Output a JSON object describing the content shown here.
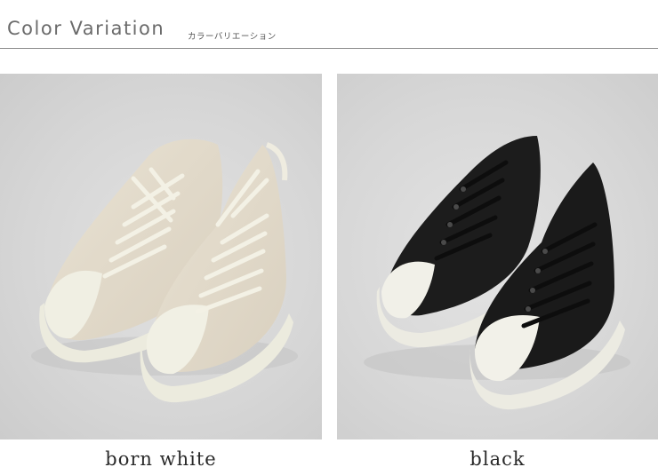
{
  "header": {
    "title": "Color Variation",
    "subtitle": "カラーバリエーション"
  },
  "variations": [
    {
      "label": "born white",
      "upper_color": "#e3dccd",
      "sole_color": "#efeee2",
      "lace_color": "#f2f0e4"
    },
    {
      "label": "black",
      "upper_color": "#1a1a1a",
      "sole_color": "#eeede4",
      "lace_color": "#151515"
    }
  ],
  "colors": {
    "background": "#ffffff",
    "panel": "#d8d8d8",
    "rule": "#8a8a8a",
    "title_text": "#6b6b6b"
  }
}
